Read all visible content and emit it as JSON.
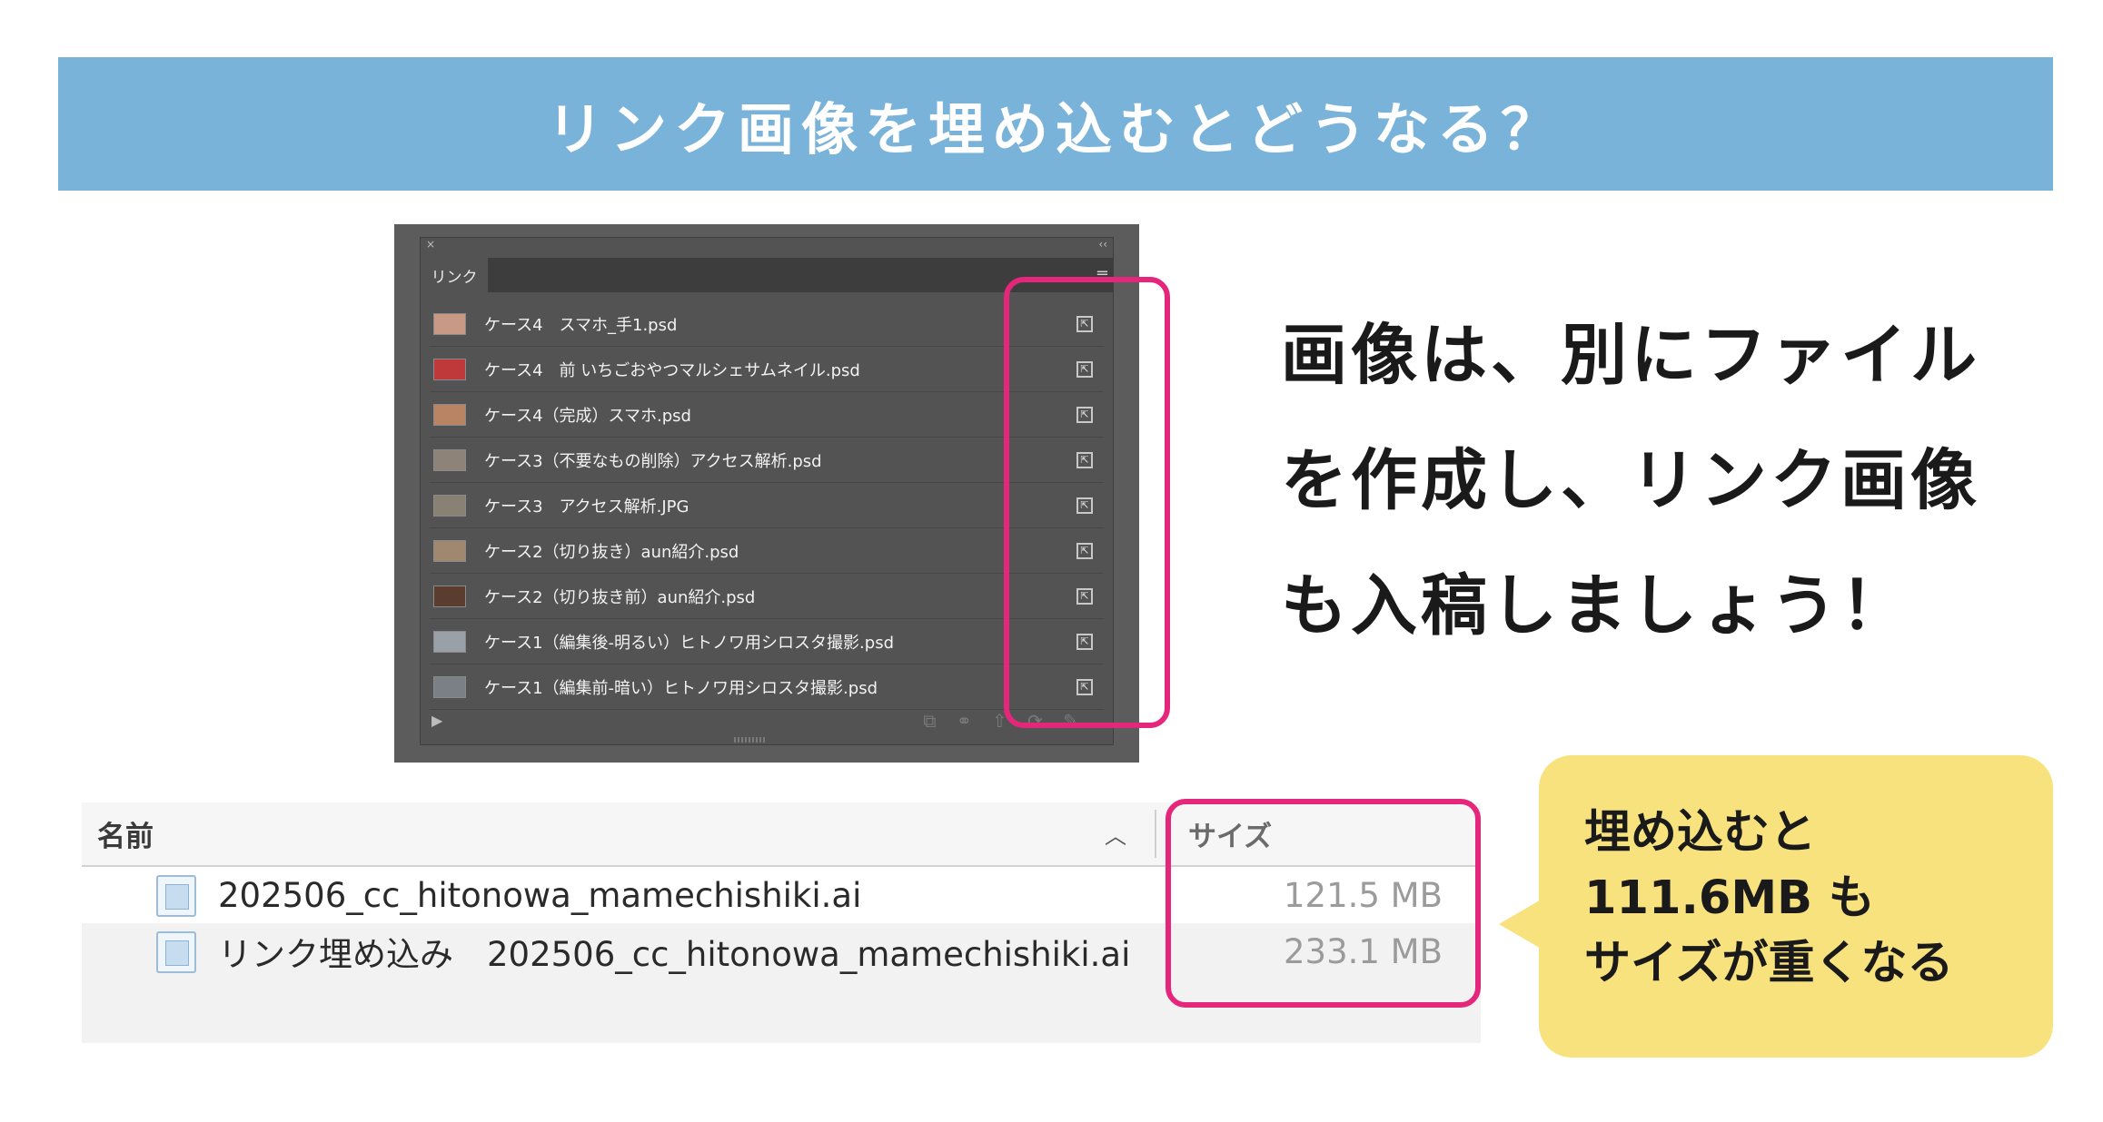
{
  "banner": {
    "title": "リンク画像を埋め込むとどうなる？"
  },
  "links_panel": {
    "close_glyph": "×",
    "collapse_glyph": "‹‹",
    "tab_label": "リンク",
    "menu_glyph": "≡",
    "status_icon_glyph": "⇱",
    "play_glyph": "▶",
    "tools_glyph": "⧉ ⚭ ⇧ ⟳ ✎",
    "items": [
      {
        "name": "ケース4　スマホ_手1.psd",
        "thumb_color": "#c89a86"
      },
      {
        "name": "ケース4　前 いちごおやつマルシェサムネイル.psd",
        "thumb_color": "#c0393a"
      },
      {
        "name": "ケース4（完成）スマホ.psd",
        "thumb_color": "#b98463"
      },
      {
        "name": "ケース3（不要なもの削除）アクセス解析.psd",
        "thumb_color": "#8d8378"
      },
      {
        "name": "ケース3　アクセス解析.JPG",
        "thumb_color": "#8a8175"
      },
      {
        "name": "ケース2（切り抜き）aun紹介.psd",
        "thumb_color": "#a08870"
      },
      {
        "name": "ケース2（切り抜き前）aun紹介.psd",
        "thumb_color": "#5a3d2f"
      },
      {
        "name": "ケース1（編集後-明るい）ヒトノワ用シロスタ撮影.psd",
        "thumb_color": "#9aa0a8"
      },
      {
        "name": "ケース1（編集前-暗い）ヒトノワ用シロスタ撮影.psd",
        "thumb_color": "#7b7f86"
      }
    ]
  },
  "explanation": {
    "line1": "画像は、別にファイル",
    "line2": "を作成し、リンク画像",
    "line3": "も入稿しましょう！"
  },
  "file_list": {
    "col_name": "名前",
    "sort_glyph": "︿",
    "col_size": "サイズ",
    "rows": [
      {
        "name": "202506_cc_hitonowa_mamechishiki.ai",
        "size": "121.5 MB"
      },
      {
        "name": "リンク埋め込み　202506_cc_hitonowa_mamechishiki.ai",
        "size": "233.1 MB"
      }
    ]
  },
  "callout": {
    "line1": "埋め込むと",
    "line2": "111.6MB も",
    "line3": "サイズが重くなる"
  },
  "colors": {
    "banner": "#7ab3da",
    "highlight": "#e5277b",
    "callout": "#f7e27e",
    "panel": "#535353"
  }
}
